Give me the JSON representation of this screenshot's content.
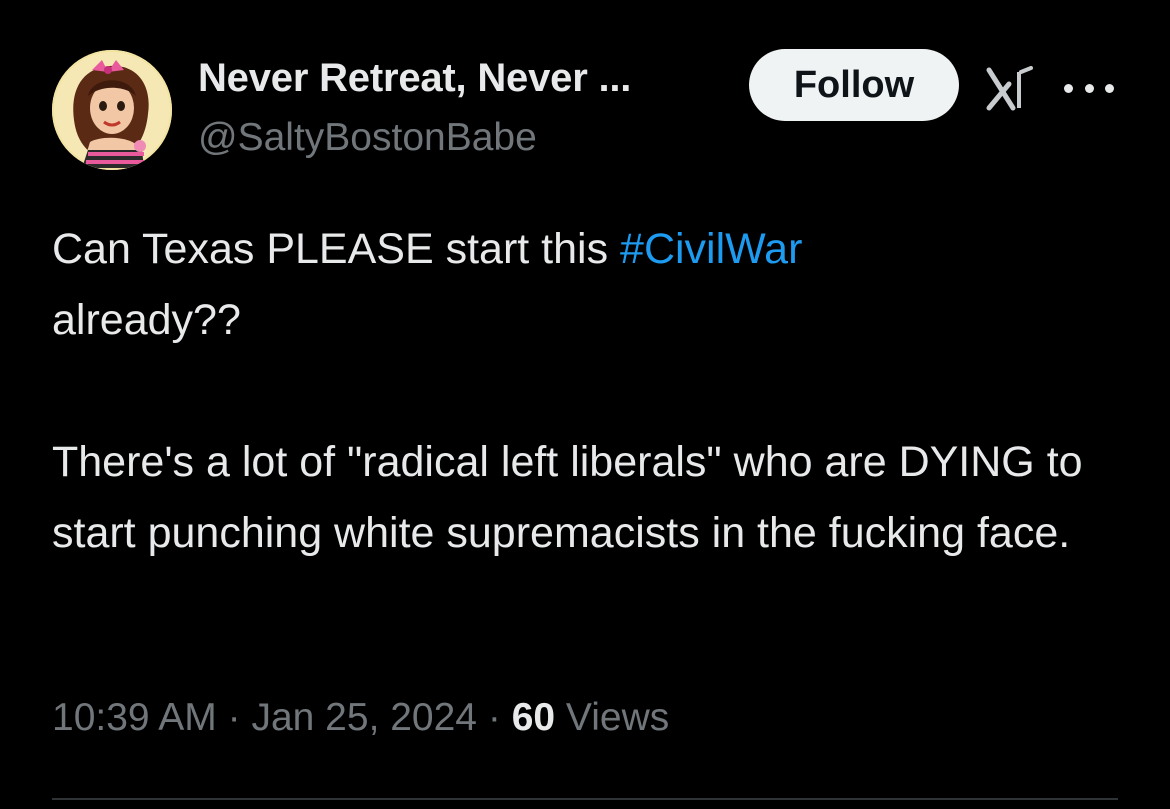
{
  "author": {
    "display_name": "Never Retreat, Never ...",
    "handle": "@SaltyBostonBabe"
  },
  "actions": {
    "follow_label": "Follow",
    "grok_icon": "grok-icon",
    "more_icon": "more-options-icon"
  },
  "tweet": {
    "line1_before": "Can Texas PLEASE start this ",
    "hashtag": "#CivilWar",
    "line1_after": "already??",
    "paragraph2": "There's a lot of \"radical left liberals\" who are DYING to start punching white supremacists in the fucking face."
  },
  "meta": {
    "time": "10:39 AM",
    "separator": "·",
    "date": "Jan 25, 2024",
    "views_count": "60",
    "views_label": "Views"
  },
  "colors": {
    "background": "#000000",
    "text": "#e7e9ea",
    "secondary": "#71767b",
    "link": "#1d9bf0",
    "button_bg": "#eff3f4"
  }
}
